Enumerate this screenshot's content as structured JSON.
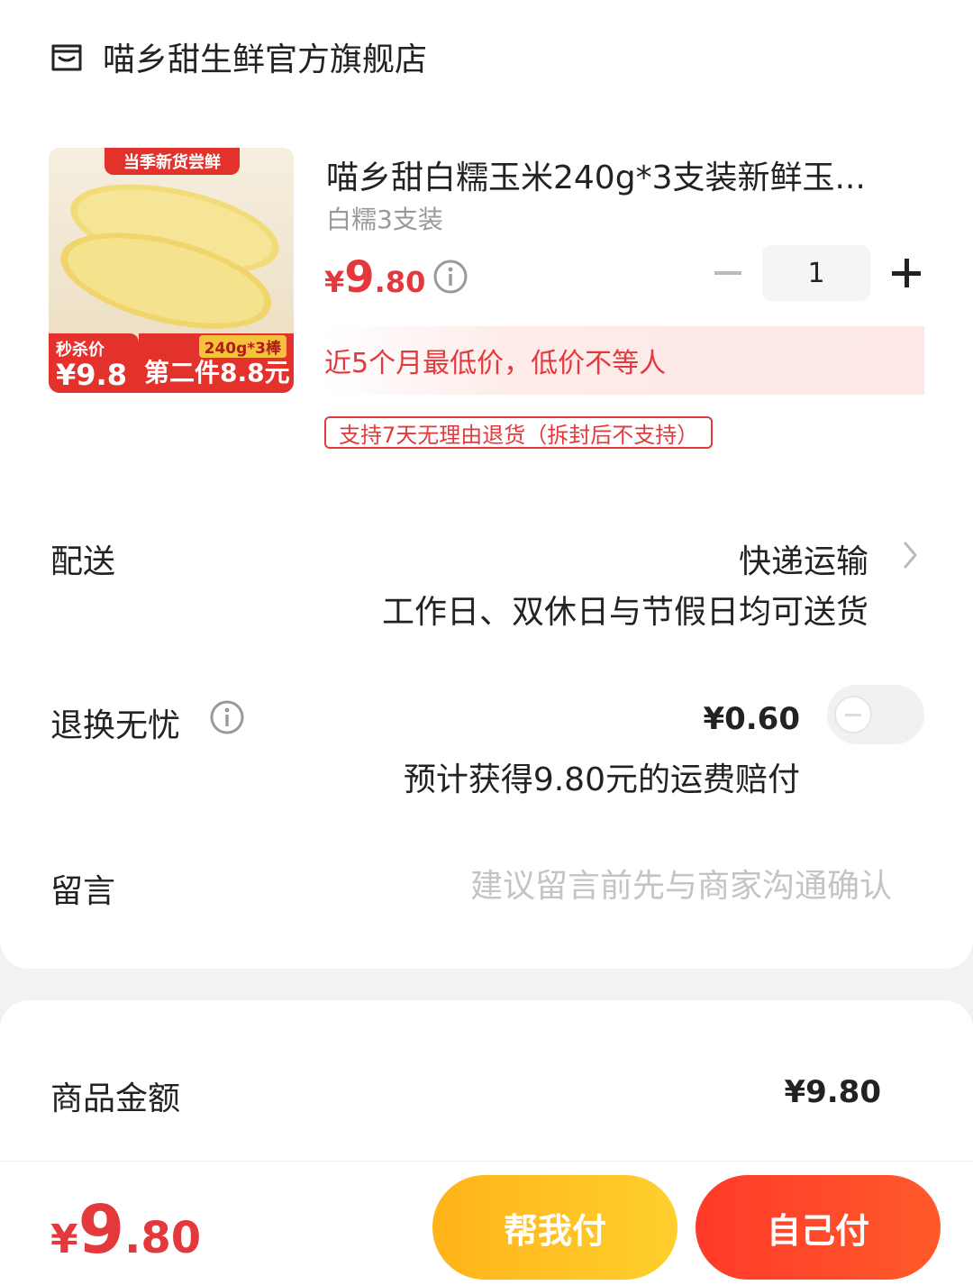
{
  "store": {
    "name": "喵乡甜生鲜官方旗舰店",
    "icon": "store-icon"
  },
  "product": {
    "title": "喵乡甜白糯玉米240g*3支装新鲜玉...",
    "spec": "白糯3支装",
    "price": {
      "currency": "¥",
      "integer": "9",
      "decimal": ".80"
    },
    "quantity": "1",
    "low_price_notice": "近5个月最低价，低价不等人",
    "return_policy": "支持7天无理由退货（拆封后不支持）",
    "image": {
      "banner": "当季新货尝鲜",
      "flash_label": "秒杀价",
      "flash_price": "¥9.8",
      "pack": "240g*3棒",
      "second_item": "第二件8.8元"
    }
  },
  "delivery": {
    "label": "配送",
    "method": "快递运输",
    "note": "工作日、双休日与节假日均可送货"
  },
  "return_insurance": {
    "label": "退换无忧",
    "fee": "¥0.60",
    "note": "预计获得9.80元的运费赔付",
    "enabled": false
  },
  "message": {
    "label": "留言",
    "placeholder": "建议留言前先与商家沟通确认"
  },
  "summary": {
    "goods_amount_label": "商品金额",
    "goods_amount": "¥9.80"
  },
  "footer": {
    "total": {
      "currency": "¥",
      "integer": "9",
      "decimal": ".80"
    },
    "help_pay_label": "帮我付",
    "self_pay_label": "自己付"
  },
  "colors": {
    "accent": "#e4393c",
    "help_button": "#ffc125",
    "pay_button": "#ff3a2a"
  }
}
